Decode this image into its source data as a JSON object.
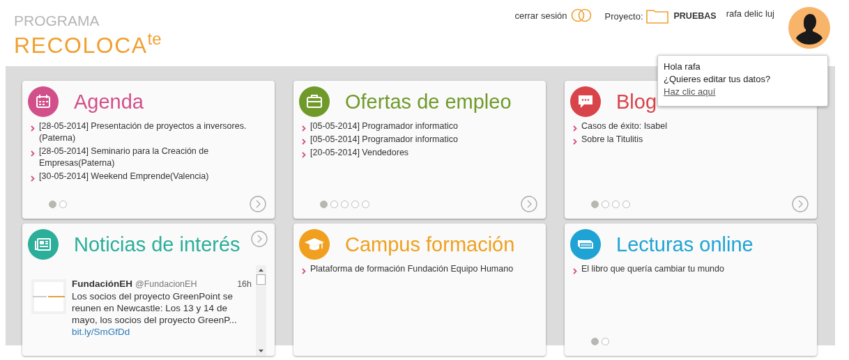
{
  "header": {
    "logo_top": "PROGRAMA",
    "logo_main": "RECOLOCA$^{te}$",
    "logout": "cerrar sesión",
    "project_label": "Proyecto:",
    "project": "PRUEBAS",
    "user": "rafa delic luj"
  },
  "popup": {
    "greeting": "Hola rafa",
    "question": "¿Quieres editar tus datos?",
    "link": "Haz clic aquí"
  },
  "cards": [
    {
      "kind": "list",
      "title": "Agenda",
      "color": "#d2508a",
      "items": [
        "[28-05-2014] Presentación de proyectos a inversores. (Paterna)",
        "[28-05-2014] Seminario para la Creación de Empresas(Paterna)",
        "[30-05-2014] Weekend Emprende(Valencia)"
      ],
      "dots": [
        {
          "selected": true
        },
        {
          "selected": false
        }
      ],
      "next_button": true
    },
    {
      "kind": "list",
      "title": "Ofertas de empleo",
      "color": "#6f9a2a",
      "items": [
        "[05-05-2014] Programador informatico",
        "[05-05-2014] Programador informatico",
        "[20-05-2014] Vendedores"
      ],
      "dots": [
        {
          "selected": true
        },
        {
          "selected": false
        },
        {
          "selected": false
        },
        {
          "selected": false
        },
        {
          "selected": false
        }
      ],
      "next_button": true
    },
    {
      "kind": "list",
      "title": "Blog",
      "color": "#d9434a",
      "items": [
        "Casos de éxito: Isabel",
        "Sobre la Titulitis"
      ],
      "dots": [
        {
          "selected": true
        },
        {
          "selected": false
        },
        {
          "selected": false
        },
        {
          "selected": false
        }
      ],
      "next_button": true
    },
    {
      "kind": "tweets",
      "title": "Noticias de interés",
      "color": "#2bae9a",
      "next_button": true,
      "tweets": [
        {
          "name": "FundaciónEH",
          "handle": "@FundacionEH",
          "time": "16h",
          "text": "Los socios del proyecto GreenPoint se reunen en Newcastle: Los 13 y 14 de mayo, los socios del proyecto GreenP...",
          "link": "bit.ly/SmGfDd"
        }
      ]
    },
    {
      "kind": "list",
      "title": "Campus formación",
      "color": "#f0a01e",
      "items": [
        "Plataforma de formación Fundación Equipo Humano"
      ],
      "next_button": false
    },
    {
      "kind": "list",
      "title": "Lecturas online",
      "color": "#1fa3d4",
      "items": [
        "El libro que quería cambiar tu mundo"
      ],
      "dots": [
        {
          "selected": true
        },
        {
          "selected": false
        }
      ],
      "next_button": false
    }
  ]
}
